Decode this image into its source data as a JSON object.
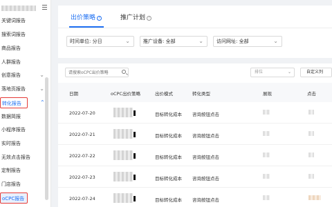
{
  "sidebar": {
    "items": [
      {
        "label": "关键词报告",
        "chev": ""
      },
      {
        "label": "搜索词报告",
        "chev": ""
      },
      {
        "label": "商品报告",
        "chev": ""
      },
      {
        "label": "人群报告",
        "chev": ""
      },
      {
        "label": "创意报告",
        "chev": "⌄"
      },
      {
        "label": "落地页报告",
        "chev": "⌄"
      },
      {
        "label": "转化报告",
        "chev": "⌃"
      },
      {
        "label": "数据简报",
        "chev": ""
      },
      {
        "label": "小程序报告",
        "chev": ""
      },
      {
        "label": "实时报告",
        "chev": ""
      },
      {
        "label": "无效点击报告",
        "chev": ""
      },
      {
        "label": "定制报告",
        "chev": ""
      },
      {
        "label": "门店报告",
        "chev": ""
      },
      {
        "label": "oCPC报告",
        "chev": ""
      }
    ]
  },
  "tabs": [
    {
      "label": "出价策略",
      "icon": "question-icon"
    },
    {
      "label": "推广计划",
      "icon": "question-icon"
    }
  ],
  "filters": [
    {
      "label": "时间单位: 分日"
    },
    {
      "label": "推广设备: 全部"
    },
    {
      "label": "访问网址: 全部"
    }
  ],
  "toolbar": {
    "search_placeholder": "请搜索oCPC出价策略",
    "sort_placeholder": "排位",
    "custom_label": "自定义列"
  },
  "table": {
    "columns": [
      "日期",
      "oCPC出价策略",
      "出价模式",
      "转化类型",
      "展现",
      "点击"
    ],
    "rows": [
      {
        "date": "2022-07-20",
        "mode": "目标转化成本",
        "conv": "咨询按钮点击"
      },
      {
        "date": "2022-07-21",
        "mode": "目标转化成本",
        "conv": "咨询按钮点击"
      },
      {
        "date": "2022-07-22",
        "mode": "目标转化成本",
        "conv": "咨询按钮点击"
      },
      {
        "date": "2022-07-23",
        "mode": "目标转化成本",
        "conv": "咨询按钮点击"
      },
      {
        "date": "2022-07-24",
        "mode": "目标转化成本",
        "conv": "咨询按钮点击"
      }
    ]
  },
  "colors": {
    "accent": "#1d6ff2",
    "highlight_box": "#e53935",
    "selected_bg": "#e8f0fe"
  }
}
